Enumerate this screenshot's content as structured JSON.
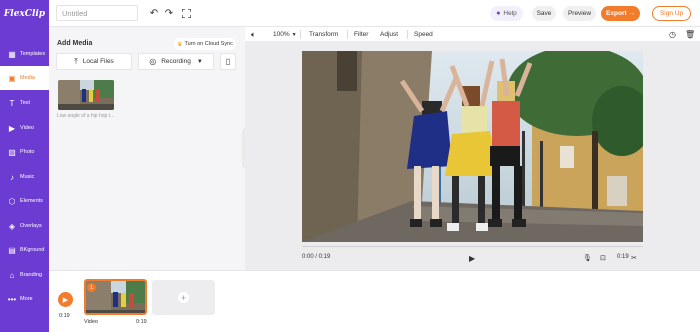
{
  "app": {
    "logo_text": "FlexClip"
  },
  "header": {
    "title_placeholder": "Untitled",
    "help_label": "Help",
    "save_label": "Save",
    "preview_label": "Preview",
    "export_label": "Export →",
    "signup_label": "Sign Up"
  },
  "sidebar": {
    "items": [
      {
        "label": "Templates",
        "icon": "templates-icon"
      },
      {
        "label": "Media",
        "icon": "media-icon",
        "active": true
      },
      {
        "label": "Text",
        "icon": "text-icon"
      },
      {
        "label": "Video",
        "icon": "video-icon"
      },
      {
        "label": "Photo",
        "icon": "photo-icon"
      },
      {
        "label": "Music",
        "icon": "music-icon"
      },
      {
        "label": "Elements",
        "icon": "elements-icon"
      },
      {
        "label": "Overlays",
        "icon": "overlays-icon"
      },
      {
        "label": "BKground",
        "icon": "background-icon"
      },
      {
        "label": "Branding",
        "icon": "branding-icon"
      },
      {
        "label": "More",
        "icon": "more-icon"
      }
    ]
  },
  "panel": {
    "title": "Add Media",
    "cloud_sync_label": "Turn on Cloud Sync",
    "local_files_label": "Local Files",
    "recording_label": "Recording",
    "media_caption": "Low angle of a hip hop t..."
  },
  "toolbar": {
    "zoom": "100%",
    "transform": "Transform",
    "filter": "Filter",
    "adjust": "Adjust",
    "speed": "Speed"
  },
  "player": {
    "current_time": "0:00 / 0:19",
    "duration": "0:19"
  },
  "timeline": {
    "time": "0:19",
    "clip_number": "1",
    "clip_label": "Video",
    "clip_duration": "0:19"
  },
  "colors": {
    "brand_purple": "#6c3bd1",
    "accent_orange": "#f07c2c"
  }
}
